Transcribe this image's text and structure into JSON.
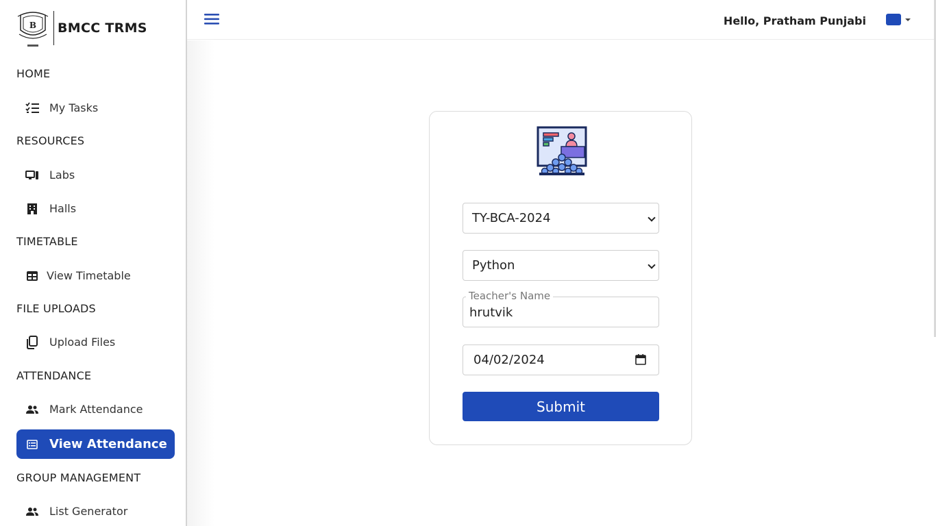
{
  "brand": {
    "name": "BMCC TRMS",
    "logo_icon": "college-crest-icon"
  },
  "sidebar": {
    "sections": [
      {
        "heading": "HOME",
        "items": [
          {
            "label": "My Tasks",
            "icon": "task-list-icon"
          }
        ]
      },
      {
        "heading": "RESOURCES",
        "items": [
          {
            "label": "Labs",
            "icon": "computer-icon"
          },
          {
            "label": "Halls",
            "icon": "building-icon"
          }
        ]
      },
      {
        "heading": "TIMETABLE",
        "items": [
          {
            "label": "View Timetable",
            "icon": "table-icon"
          }
        ]
      },
      {
        "heading": "FILE UPLOADS",
        "items": [
          {
            "label": "Upload Files",
            "icon": "files-icon"
          }
        ]
      },
      {
        "heading": "ATTENDANCE",
        "items": [
          {
            "label": "Mark Attendance",
            "icon": "people-icon"
          },
          {
            "label": "View Attendance",
            "icon": "list-icon",
            "active": true
          }
        ]
      },
      {
        "heading": "GROUP MANAGEMENT",
        "items": [
          {
            "label": "List Generator",
            "icon": "people-icon"
          }
        ]
      }
    ]
  },
  "header": {
    "greeting": "Hello, Pratham Punjabi",
    "menu_icon": "hamburger-icon",
    "flag_color": "#1f4bb8"
  },
  "form": {
    "class_select": "TY-BCA-2024",
    "subject_select": "Python",
    "teacher_label": "Teacher's Name",
    "teacher_value": "hrutvik",
    "date_value": "04/02/2024",
    "submit_label": "Submit",
    "illustration_icon": "classroom-presentation-icon"
  },
  "colors": {
    "primary": "#1f4bb8"
  }
}
